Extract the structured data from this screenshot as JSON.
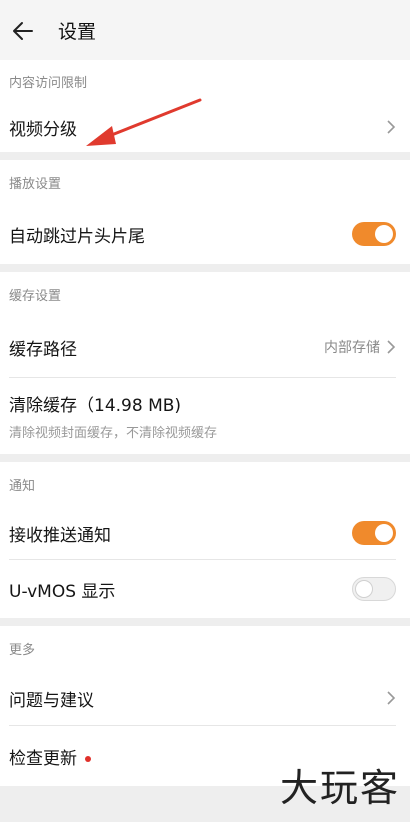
{
  "header": {
    "title": "设置"
  },
  "sections": {
    "content_limit": {
      "title": "内容访问限制",
      "video_rating": "视频分级"
    },
    "playback": {
      "title": "播放设置",
      "skip_intro": "自动跳过片头片尾",
      "skip_intro_on": true
    },
    "cache": {
      "title": "缓存设置",
      "path_label": "缓存路径",
      "path_value": "内部存储",
      "clear_label": "清除缓存（14.98 MB)",
      "clear_sub": "清除视频封面缓存，不清除视频缓存"
    },
    "notify": {
      "title": "通知",
      "push_label": "接收推送通知",
      "push_on": true,
      "umos_label": "U-vMOS 显示",
      "umos_on": false
    },
    "more": {
      "title": "更多",
      "feedback": "问题与建议",
      "update": "检查更新"
    }
  },
  "watermark": "大玩客",
  "colors": {
    "accent": "#f08a2c",
    "annotation": "#e03a2e",
    "badge": "#e0302a"
  }
}
